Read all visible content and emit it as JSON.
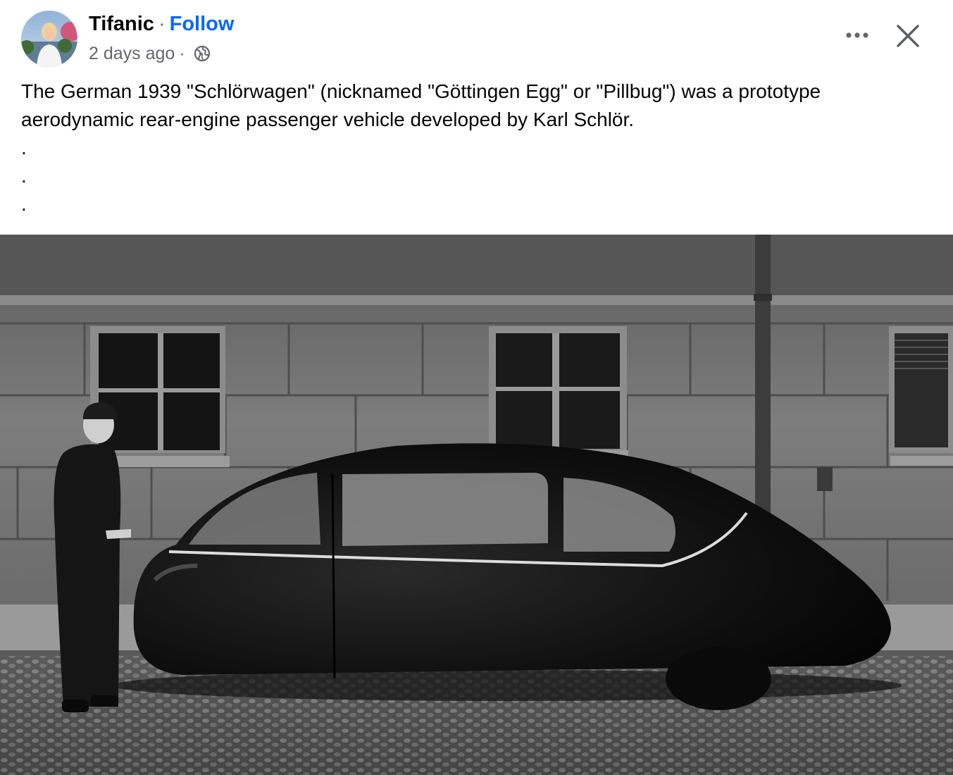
{
  "post": {
    "author": "Tifanic",
    "separator": "·",
    "follow_label": "Follow",
    "timestamp": "2 days ago",
    "audience_separator": "·",
    "audience_icon": "globe-icon",
    "text": "The German 1939 \"Schlörwagen\" (nicknamed \"Göttingen Egg\" or \"Pillbug\") was a prototype aerodynamic rear-engine passenger vehicle developed by Karl Schlör.\n.\n.\n.",
    "more_icon": "more-horizontal-icon",
    "close_icon": "close-icon"
  },
  "photo": {
    "subject": "black-and-white photograph of a man standing beside a streamlined black car in front of a stone building"
  },
  "colors": {
    "link": "#0866ff",
    "secondary_text": "#65676b",
    "primary_text": "#050505"
  }
}
